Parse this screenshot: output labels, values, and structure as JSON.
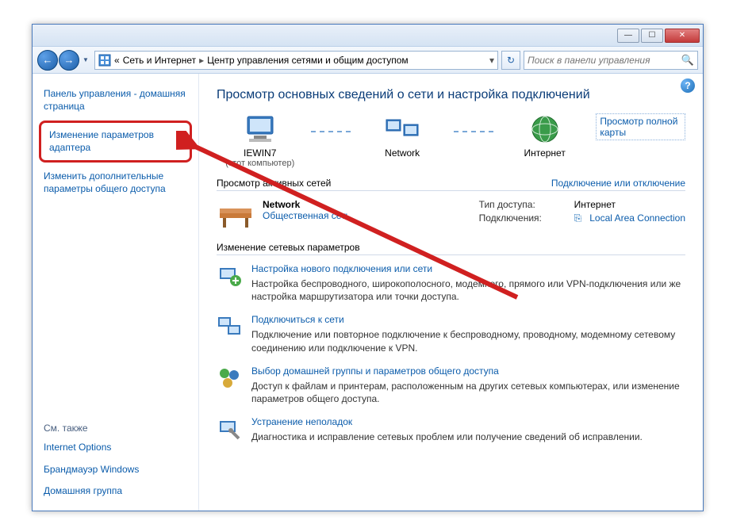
{
  "titlebar": {
    "min": "—",
    "max": "☐",
    "close": "✕"
  },
  "nav": {
    "back": "←",
    "fwd": "→",
    "dd": "▼",
    "refresh": "↻"
  },
  "breadcrumb": {
    "prefix": "«",
    "part1": "Сеть и Интернет",
    "sep": "▸",
    "part2": "Центр управления сетями и общим доступом",
    "dd": "▾"
  },
  "search": {
    "placeholder": "Поиск в панели управления"
  },
  "sidebar": {
    "home": "Панель управления - домашняя страница",
    "highlight": "Изменение параметров адаптера",
    "advanced": "Изменить дополнительные параметры общего доступа",
    "see_also": "См. также",
    "links": [
      "Internet Options",
      "Брандмауэр Windows",
      "Домашняя группа"
    ]
  },
  "main": {
    "heading": "Просмотр основных сведений о сети и настройка подключений",
    "map_full": "Просмотр полной карты",
    "map": {
      "pc": "IEWIN7",
      "pc_sub": "(этот компьютер)",
      "net": "Network",
      "inet": "Интернет"
    },
    "active_hd_left": "Просмотр активных сетей",
    "active_hd_right": "Подключение или отключение",
    "network": {
      "name": "Network",
      "type_label": "Общественная сеть",
      "access_lbl": "Тип доступа:",
      "access_val": "Интернет",
      "conn_lbl": "Подключения:",
      "conn_val": "Local Area Connection"
    },
    "change_hd": "Изменение сетевых параметров",
    "tasks": [
      {
        "title": "Настройка нового подключения или сети",
        "desc": "Настройка беспроводного, широкополосного, модемного, прямого или VPN-подключения или же настройка маршрутизатора или точки доступа."
      },
      {
        "title": "Подключиться к сети",
        "desc": "Подключение или повторное подключение к беспроводному, проводному, модемному сетевому соединению или подключение к VPN."
      },
      {
        "title": "Выбор домашней группы и параметров общего доступа",
        "desc": "Доступ к файлам и принтерам, расположенным на других сетевых компьютерах, или изменение параметров общего доступа."
      },
      {
        "title": "Устранение неполадок",
        "desc": "Диагностика и исправление сетевых проблем или получение сведений об исправлении."
      }
    ]
  }
}
